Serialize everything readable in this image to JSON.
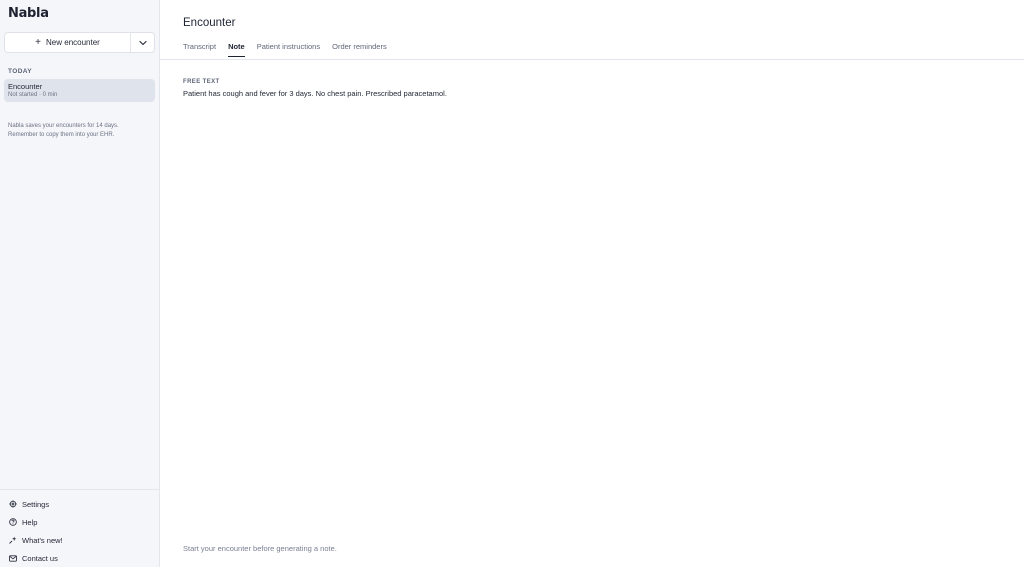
{
  "sidebar": {
    "brand": "Nabla",
    "new_encounter_label": "New encounter",
    "section_label": "TODAY",
    "encounters": [
      {
        "title": "Encounter",
        "subtitle": "Not started · 0 min"
      }
    ],
    "info_line1": "Nabla saves your encounters for 14 days.",
    "info_line2": "Remember to copy them into your EHR.",
    "links": [
      {
        "label": "Settings",
        "icon": "gear-icon"
      },
      {
        "label": "Help",
        "icon": "help-icon"
      },
      {
        "label": "What's new!",
        "icon": "sparkle-icon"
      },
      {
        "label": "Contact us",
        "icon": "mail-icon"
      }
    ]
  },
  "main": {
    "title": "Encounter",
    "tabs": [
      {
        "label": "Transcript",
        "active": false
      },
      {
        "label": "Note",
        "active": true
      },
      {
        "label": "Patient instructions",
        "active": false
      },
      {
        "label": "Order reminders",
        "active": false
      }
    ],
    "field_label": "FREE TEXT",
    "field_value": "Patient has cough and fever for 3 days. No chest pain. Prescribed paracetamol.",
    "footer_hint": "Start your encounter before generating a note."
  }
}
